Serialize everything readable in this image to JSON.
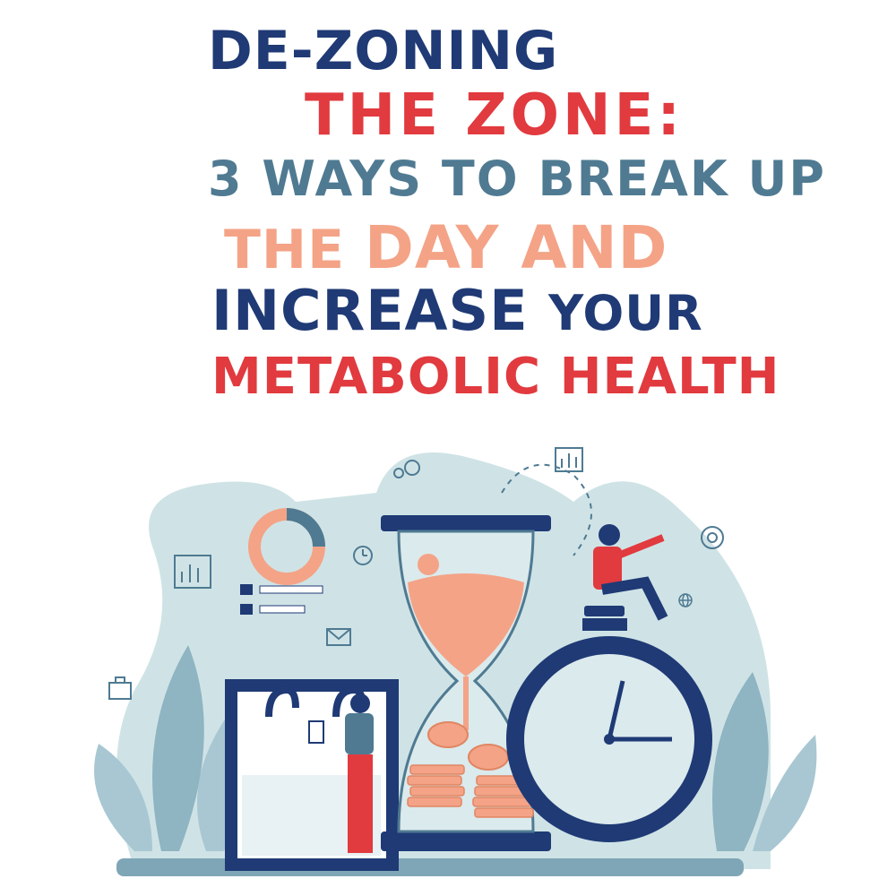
{
  "title": {
    "line1": "DE-ZONING",
    "line2": "THE ZONE:",
    "line3": "3 WAYS TO BREAK UP",
    "line4_a": "THE ",
    "line4_b": "DAY AND",
    "line5_a": "INCREASE ",
    "line5_b": "YOUR",
    "line6": "METABOLIC HEALTH"
  },
  "colors": {
    "navy": "#1f3a75",
    "red": "#e13a3f",
    "steel": "#4f7a92",
    "peach": "#f4a387",
    "pale_blue": "#cfe3e6",
    "leaf_blue": "#8fb4c2",
    "ground": "#7fa6b7"
  },
  "illustration": {
    "icons": [
      "chart-icon",
      "gear-icon",
      "pie-chart-icon",
      "clock-icon",
      "mail-icon",
      "briefcase-icon",
      "globe-icon",
      "target-icon",
      "hourglass-icon",
      "calendar-icon",
      "stopwatch-icon",
      "coin-icon"
    ]
  }
}
